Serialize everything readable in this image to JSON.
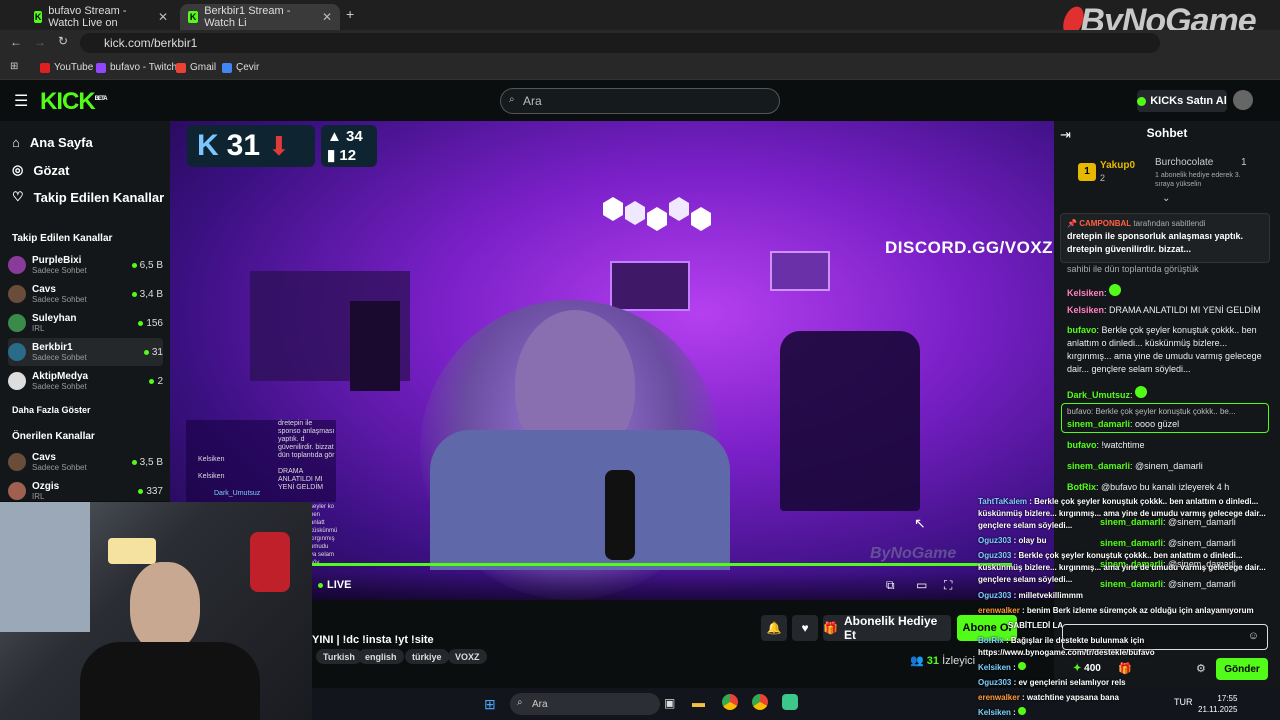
{
  "browser": {
    "tabs": [
      {
        "label": "bufavo Stream - Watch Live on"
      },
      {
        "label": "Berkbir1 Stream - Watch Li"
      }
    ],
    "url": "kick.com/berkbir1",
    "bookmarks": [
      "YouTube",
      "bufavo - Twitch",
      "Gmail",
      "Çevir"
    ]
  },
  "watermark": "ByNoGame",
  "header": {
    "logo": "KICK",
    "logo_tag": "BETA",
    "search_placeholder": "Ara",
    "kicks_button": "KICKs Satın Al"
  },
  "sidebar": {
    "nav": [
      {
        "label": "Ana Sayfa",
        "icon": "home-icon"
      },
      {
        "label": "Gözat",
        "icon": "compass-icon"
      },
      {
        "label": "Takip Edilen Kanallar",
        "icon": "heart-icon"
      }
    ],
    "followed_heading": "Takip Edilen Kanallar",
    "followed": [
      {
        "name": "PurpleBixi",
        "sub": "Sadece Sohbet",
        "count": "6,5 B"
      },
      {
        "name": "Cavs",
        "sub": "Sadece Sohbet",
        "count": "3,4 B"
      },
      {
        "name": "Suleyhan",
        "sub": "IRL",
        "count": "156"
      },
      {
        "name": "Berkbir1",
        "sub": "Sadece Sohbet",
        "count": "31"
      },
      {
        "name": "AktipMedya",
        "sub": "Sadece Sohbet",
        "count": "2"
      }
    ],
    "show_more": "Daha Fazla Göster",
    "recommended_heading": "Önerilen Kanallar",
    "recommended": [
      {
        "name": "Cavs",
        "sub": "Sadece Sohbet",
        "count": "3,5 B"
      },
      {
        "name": "Ozgis",
        "sub": "IRL",
        "count": "337"
      }
    ]
  },
  "video": {
    "overlay_badge_number": "31",
    "overlay_stats": [
      "34",
      "12"
    ],
    "discord_text": "DISCORD.GG/VOXZ",
    "live_label": "LIVE",
    "overlay_chat": [
      {
        "user": "",
        "text": "dretepin ile sponso anlaşması yaptık. d güvenilirdir. bizzat dün toplantıda gör"
      },
      {
        "user": "Kelsiken",
        "text": ""
      },
      {
        "user": "Kelsiken",
        "text": "DRAMA ANLATILDI MI YENİ GELDİM"
      },
      {
        "user": "Dark_Umutsuz",
        "text": ""
      }
    ],
    "overlay_chat_extra": "şeyler ko ben anlatt küskünmü kırgınmış umudu va selam söy",
    "overlay_watermark": "ByNoGame"
  },
  "stream": {
    "title": "YINI | !dc !insta !yt !site",
    "tags": [
      "Turkish",
      "english",
      "türkiye",
      "VOXZ"
    ],
    "gift_button": "Abonelik Hediye Et",
    "subscribe_button": "Abone Ol",
    "viewers_count": "31",
    "viewers_label": "İzleyici"
  },
  "chat": {
    "title": "Sohbet",
    "leaderboard": [
      {
        "name": "Yakup0",
        "count": "2"
      },
      {
        "name": "Burchocolate",
        "count": "1"
      }
    ],
    "leaderboard_note": "1 abonelik hediye ederek 3. sıraya yükselin",
    "pinned_by_user": "CAMPONBAL",
    "pinned_by_suffix": "tarafından sabitlendi",
    "pinned_text": "dretepin ile sponsorluk anlaşması yaptık. dretepin güvenilirdir. bizzat...",
    "partial_line": "sahibi ile dün toplantıda görüştük",
    "messages": [
      {
        "user": "Kelsiken",
        "text": ""
      },
      {
        "user": "Kelsiken",
        "text": "DRAMA ANLATILDI MI YENİ GELDİM"
      },
      {
        "user": "bufavo",
        "text": "Berkle çok şeyler konuştuk çokkk.. ben anlattım o dinledi... küskünmüş bizlere... kırgınmış... ama yine de umudu varmış gelecege dair... gençlere selam söyledi..."
      },
      {
        "user": "Dark_Umutsuz",
        "text": ""
      },
      {
        "user": "sinem_damarli",
        "text": "oooo güzel"
      },
      {
        "user": "bufavo",
        "text": "!watchtime"
      },
      {
        "user": "sinem_damarli",
        "text": "@sinem_damarli"
      },
      {
        "user": "BotRix",
        "text": "@bufavo bu kanalı izleyerek 4 h"
      },
      {
        "user": "sinem_damarli",
        "text": "@sinem_damarli"
      },
      {
        "user": "sinem_damarli",
        "text": "@sinem_damarli"
      },
      {
        "user": "sinem_damarli",
        "text": "@sinem_damarli"
      },
      {
        "user": "sinem_damarli",
        "text": "@sinem_damarli"
      }
    ],
    "reply_preview": "bufavo: Berkle çok şeyler konuştuk çokkk.. be...",
    "points": "400",
    "send_button": "Gönder"
  },
  "overlay_chat2": [
    {
      "user": "TahtTaKalem",
      "text": "Berkle çok şeyler konuştuk çokkk.. ben anlattım o dinledi..."
    },
    {
      "user": "",
      "text": "küskünmüş bizlere... kırgınmış... ama yine de umudu varmış gelecege dair..."
    },
    {
      "user": "",
      "text": "gençlere selam söyledi..."
    },
    {
      "user": "Oguz303",
      "text": "olay bu"
    },
    {
      "user": "Oguz303",
      "text": "Berkle çok şeyler konuştuk çokkk.. ben anlattım o dinledi..."
    },
    {
      "user": "",
      "text": "küskünmüş bizlere... kırgınmış... ama yine de umudu varmış gelecege dair..."
    },
    {
      "user": "",
      "text": "gençlere selam söyledi..."
    },
    {
      "user": "Oguz303",
      "text": "milletvekillimmm"
    },
    {
      "user": "erenwalker",
      "text": "benim Berk izleme süremçok az olduğu için anlayamıyorum"
    },
    {
      "user": "",
      "text": "SABİTLEDİ LA"
    },
    {
      "user": "BotRix",
      "text": "Bağışlar ile destekte bulunmak için"
    },
    {
      "user": "",
      "text": "https://www.bynogame.com/tr/destekle/bufavo"
    },
    {
      "user": "Kelsiken",
      "text": ""
    },
    {
      "user": "Oguz303",
      "text": "ev gençlerini selamlıyor rels"
    },
    {
      "user": "erenwalker",
      "text": "watchtine yapsana bana"
    },
    {
      "user": "Kelsiken",
      "text": ""
    }
  ],
  "taskbar": {
    "search": "Ara",
    "lang": "TUR",
    "time": "17:55",
    "date": "21.11.2025"
  }
}
